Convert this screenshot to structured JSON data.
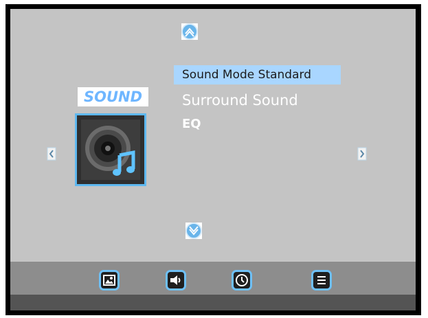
{
  "menu": {
    "section_title": "SOUND",
    "items": [
      {
        "label": "Sound Mode Standard",
        "selected": true
      },
      {
        "label": "Surround Sound",
        "selected": false
      },
      {
        "label": "EQ",
        "selected": false
      }
    ]
  },
  "icons": {
    "category": "speaker-music-icon",
    "up": "chevron-up-icon",
    "down": "chevron-down-icon",
    "left": "arrow-left-icon",
    "right": "arrow-right-icon",
    "bottom_tabs": [
      "picture-icon",
      "sound-icon",
      "time-icon",
      "menu-icon"
    ]
  },
  "colors": {
    "screen_bg": "#c4c4c4",
    "highlight": "#a9d6ff",
    "accent": "#5eb8f0",
    "title_text": "#6fb6ff"
  }
}
